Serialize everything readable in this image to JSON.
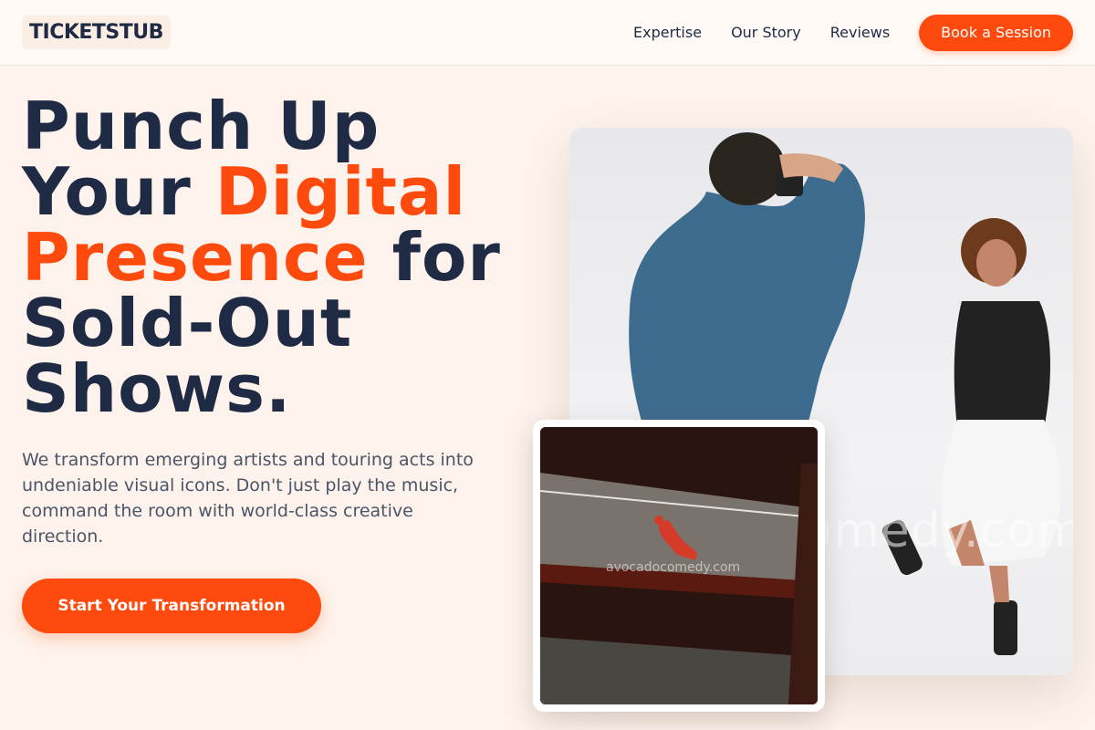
{
  "nav": {
    "logo": "TICKETSTUB",
    "links": [
      "Expertise",
      "Our Story",
      "Reviews"
    ],
    "cta": "Book a Session"
  },
  "hero": {
    "title_line1": "Punch Up",
    "title_line2_a": "Your ",
    "title_line2_b": "Digital",
    "title_line3_a": "Presence",
    "title_line3_b": " for",
    "title_line4": "Sold-Out",
    "title_line5": "Shows.",
    "subtitle": "We transform emerging artists and touring acts into undeniable visual icons. Don't just play the music, command the room with world-class creative direction.",
    "cta": "Start Your Transformation"
  },
  "images": {
    "main_watermark": "avocadocomedy.com",
    "inset_watermark": "avocadocomedy.com"
  },
  "colors": {
    "accent": "#ff4a0d",
    "navy": "#1f2a44",
    "background": "#fdf3ec"
  }
}
